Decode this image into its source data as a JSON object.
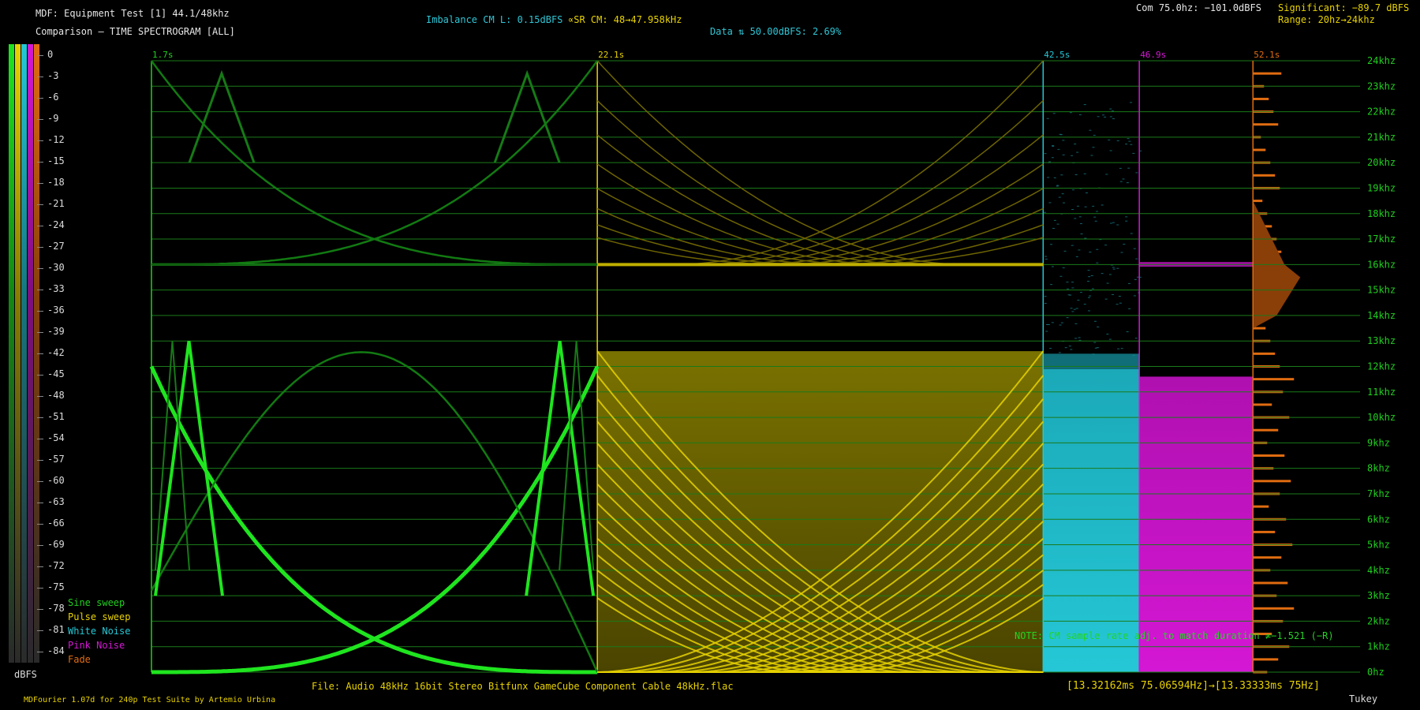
{
  "header": {
    "title": "MDF: Equipment Test [1] 44.1/48khz",
    "subtitle": "Comparison — TIME SPECTROGRAM [ALL]",
    "imbalance": "Imbalance CM L: 0.15dBFS",
    "sr_cm": "∝SR CM: 48→47.958kHz",
    "data": "Data ⇅ 50.00dBFS: 2.69%",
    "com": "Com 75.0hz: −101.0dBFS",
    "significant": "Significant: −89.7 dBFS",
    "range": "Range: 20hz→24khz"
  },
  "footer": {
    "file": "File: Audio   48kHz 16bit Stereo Bitfunx GameCube Component Cable 48kHz.flac",
    "ms": "[13.32162ms 75.06594Hz]→[13.33333ms 75Hz]",
    "credit": "MDFourier 1.07d for 240p Test Suite by Artemio Urbina",
    "window": "Tukey",
    "note": "NOTE: CM sample rate adj. to match duration ≠−1.521 (−R)"
  },
  "scale": {
    "unit_label": "dBFS",
    "ticks": [
      "0",
      "-3",
      "-6",
      "-9",
      "-12",
      "-15",
      "-18",
      "-21",
      "-24",
      "-27",
      "-30",
      "-33",
      "-36",
      "-39",
      "-42",
      "-45",
      "-48",
      "-51",
      "-54",
      "-57",
      "-60",
      "-63",
      "-66",
      "-69",
      "-72",
      "-75",
      "-78",
      "-81",
      "-84"
    ],
    "colors": [
      "#1fe51f",
      "#e8d200",
      "#25c7d6",
      "#d417d4",
      "#e06c10"
    ]
  },
  "legend": [
    {
      "label": "Sine sweep",
      "color": "#1fd01f"
    },
    {
      "label": "Pulse sweep",
      "color": "#e8d200"
    },
    {
      "label": "White Noise",
      "color": "#25c7d6"
    },
    {
      "label": "Pink Noise",
      "color": "#d417d4"
    },
    {
      "label": "Fade",
      "color": "#e06c10"
    }
  ],
  "chart_data": {
    "type": "heatmap",
    "title": "Comparison — TIME SPECTROGRAM [ALL]",
    "ylabel": "",
    "ylim": [
      0,
      24
    ],
    "y_ticks": [
      "0hz",
      "1khz",
      "2khz",
      "3khz",
      "4khz",
      "5khz",
      "6khz",
      "7khz",
      "8khz",
      "9khz",
      "10khz",
      "11khz",
      "12khz",
      "13khz",
      "14khz",
      "15khz",
      "16khz",
      "17khz",
      "18khz",
      "19khz",
      "20khz",
      "21khz",
      "22khz",
      "23khz",
      "24khz"
    ],
    "segments": [
      {
        "name": "Sine sweep",
        "start_label": "1.7s",
        "start_s": 1.7,
        "end_s": 22.1,
        "color": "#1fd01f"
      },
      {
        "name": "Pulse sweep",
        "start_label": "22.1s",
        "start_s": 22.1,
        "end_s": 42.5,
        "color": "#e8d200"
      },
      {
        "name": "White Noise",
        "start_label": "42.5s",
        "start_s": 42.5,
        "end_s": 46.9,
        "color": "#25c7d6"
      },
      {
        "name": "Pink Noise",
        "start_label": "46.9s",
        "start_s": 46.9,
        "end_s": 52.1,
        "color": "#d417d4"
      },
      {
        "name": "Fade",
        "start_label": "52.1s",
        "start_s": 52.1,
        "end_s": 57.0,
        "color": "#e06c10"
      }
    ],
    "grid": true
  }
}
